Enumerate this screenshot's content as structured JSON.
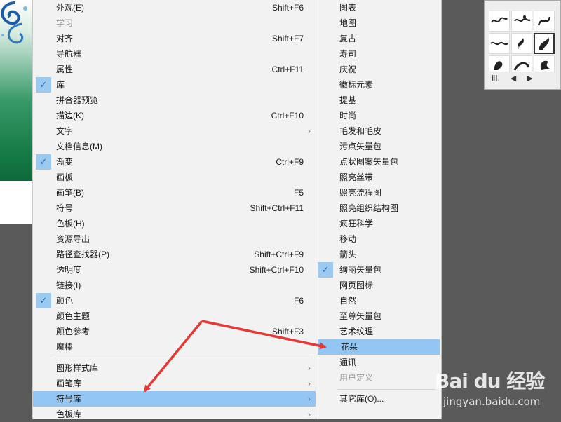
{
  "main_menu": {
    "items": [
      {
        "label": "外观(E)",
        "shortcut": "Shift+F6",
        "checked": false
      },
      {
        "label": "学习",
        "shortcut": "",
        "checked": false,
        "disabled": true
      },
      {
        "label": "对齐",
        "shortcut": "Shift+F7",
        "checked": false
      },
      {
        "label": "导航器",
        "shortcut": "",
        "checked": false
      },
      {
        "label": "属性",
        "shortcut": "Ctrl+F11",
        "checked": false
      },
      {
        "label": "库",
        "shortcut": "",
        "checked": true
      },
      {
        "label": "拼合器预览",
        "shortcut": "",
        "checked": false
      },
      {
        "label": "描边(K)",
        "shortcut": "Ctrl+F10",
        "checked": false
      },
      {
        "label": "文字",
        "shortcut": "",
        "checked": false,
        "submenu": true
      },
      {
        "label": "文档信息(M)",
        "shortcut": "",
        "checked": false
      },
      {
        "label": "渐变",
        "shortcut": "Ctrl+F9",
        "checked": true
      },
      {
        "label": "画板",
        "shortcut": "",
        "checked": false
      },
      {
        "label": "画笔(B)",
        "shortcut": "F5",
        "checked": false
      },
      {
        "label": "符号",
        "shortcut": "Shift+Ctrl+F11",
        "checked": false
      },
      {
        "label": "色板(H)",
        "shortcut": "",
        "checked": false
      },
      {
        "label": "资源导出",
        "shortcut": "",
        "checked": false
      },
      {
        "label": "路径查找器(P)",
        "shortcut": "Shift+Ctrl+F9",
        "checked": false
      },
      {
        "label": "透明度",
        "shortcut": "Shift+Ctrl+F10",
        "checked": false
      },
      {
        "label": "链接(I)",
        "shortcut": "",
        "checked": false
      },
      {
        "label": "颜色",
        "shortcut": "F6",
        "checked": true
      },
      {
        "label": "颜色主题",
        "shortcut": "",
        "checked": false
      },
      {
        "label": "颜色参考",
        "shortcut": "Shift+F3",
        "checked": false
      },
      {
        "label": "魔棒",
        "shortcut": "",
        "checked": false
      }
    ],
    "library_items": [
      {
        "label": "图形样式库",
        "submenu": true
      },
      {
        "label": "画笔库",
        "submenu": true
      },
      {
        "label": "符号库",
        "submenu": true,
        "highlighted": true
      },
      {
        "label": "色板库",
        "submenu": true
      }
    ],
    "submenu_arrow": "›",
    "check_mark": "✓"
  },
  "symbol_library_submenu": {
    "items": [
      {
        "label": "图表"
      },
      {
        "label": "地图"
      },
      {
        "label": "复古"
      },
      {
        "label": "寿司"
      },
      {
        "label": "庆祝"
      },
      {
        "label": "徽标元素"
      },
      {
        "label": "提基"
      },
      {
        "label": "时尚"
      },
      {
        "label": "毛发和毛皮"
      },
      {
        "label": "污点矢量包"
      },
      {
        "label": "点状图案矢量包"
      },
      {
        "label": "照亮丝带"
      },
      {
        "label": "照亮流程图"
      },
      {
        "label": "照亮组织结构图"
      },
      {
        "label": "疯狂科学"
      },
      {
        "label": "移动"
      },
      {
        "label": "箭头"
      },
      {
        "label": "绚丽矢量包",
        "checked": true
      },
      {
        "label": "网页图标"
      },
      {
        "label": "自然"
      },
      {
        "label": "至尊矢量包"
      },
      {
        "label": "艺术纹理"
      },
      {
        "label": "花朵",
        "highlighted": true
      },
      {
        "label": "通讯"
      },
      {
        "label": "用户定义",
        "disabled": true
      }
    ],
    "other_library": "其它库(O)..."
  },
  "symbols_panel": {
    "footer_icons": [
      "library-menu-icon",
      "previous-icon",
      "next-icon"
    ],
    "footer_glyphs": [
      "ⅡⅠ.",
      "◀",
      "▶"
    ]
  },
  "annotations": {
    "arrow_color": "#e53935"
  },
  "watermark": {
    "logo_text": "Bai du 经验",
    "url": "jingyan.baidu.com"
  },
  "colors": {
    "menu_bg": "#f2f2f2",
    "highlight": "#93c6f2",
    "check_bg": "#9cc9ef",
    "workspace": "#5a5a5a"
  }
}
